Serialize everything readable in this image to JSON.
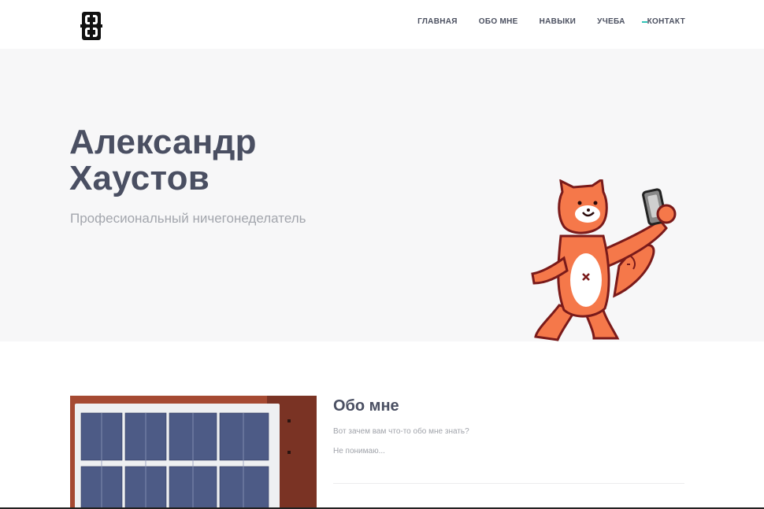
{
  "header": {
    "logo_icon": "monogram-logo-icon",
    "nav": [
      {
        "label": "ГЛАВНАЯ"
      },
      {
        "label": "ОБО МНЕ"
      },
      {
        "label": "НАВЫКИ"
      },
      {
        "label": "УЧЕБА"
      },
      {
        "label": "КОНТАКТ"
      }
    ],
    "active_marker_color": "#33c4b8"
  },
  "hero": {
    "name_line1": "Александр",
    "name_line2": "Хаустов",
    "subtitle": "Професиональный ничегонеделатель",
    "illustration": "orange-cat-holding-phone-illustration",
    "background_color": "#f7f7f8"
  },
  "about": {
    "photo": "solar-panel-photo",
    "title": "Обо мне",
    "paragraph1": "Вот зачем вам что-то обо мне знать?",
    "paragraph2": "Не понимаю..."
  },
  "colors": {
    "heading": "#4a4f62",
    "muted": "#a3a6ad",
    "mascot_orange": "#f5784a",
    "mascot_outline": "#7a1a1a"
  }
}
